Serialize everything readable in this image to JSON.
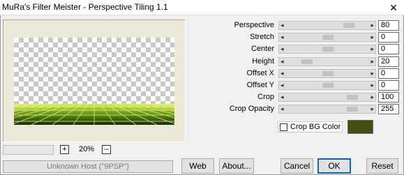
{
  "window": {
    "title": "MuRa's Filter Meister - Perspective Tiling 1.1",
    "close_glyph": "✕"
  },
  "preview": {
    "zoom": "20%",
    "zoom_in": "+",
    "zoom_out": "–",
    "floor_colors": [
      "#d7ec5a",
      "#8ab31e",
      "#3f6a08",
      "#0f2b02"
    ]
  },
  "status_text": "Unknown Host (\"9PSP\")",
  "params": [
    {
      "label": "Perspective",
      "value": "80",
      "fraction": 0.8
    },
    {
      "label": "Stretch",
      "value": "0",
      "fraction": 0.5
    },
    {
      "label": "Center",
      "value": "0",
      "fraction": 0.5
    },
    {
      "label": "Height",
      "value": "20",
      "fraction": 0.2
    },
    {
      "label": "Offset X",
      "value": "0",
      "fraction": 0.5
    },
    {
      "label": "Offset Y",
      "value": "0",
      "fraction": 0.5
    },
    {
      "label": "Crop",
      "value": "100",
      "fraction": 0.85
    },
    {
      "label": "Crop Opacity",
      "value": "255",
      "fraction": 0.85
    }
  ],
  "crop_bg": {
    "label": "Crop BG Color",
    "checked": false,
    "color": "#424e14"
  },
  "buttons": {
    "web": "Web",
    "about": "About...",
    "cancel": "Cancel",
    "ok": "OK",
    "reset": "Reset"
  }
}
